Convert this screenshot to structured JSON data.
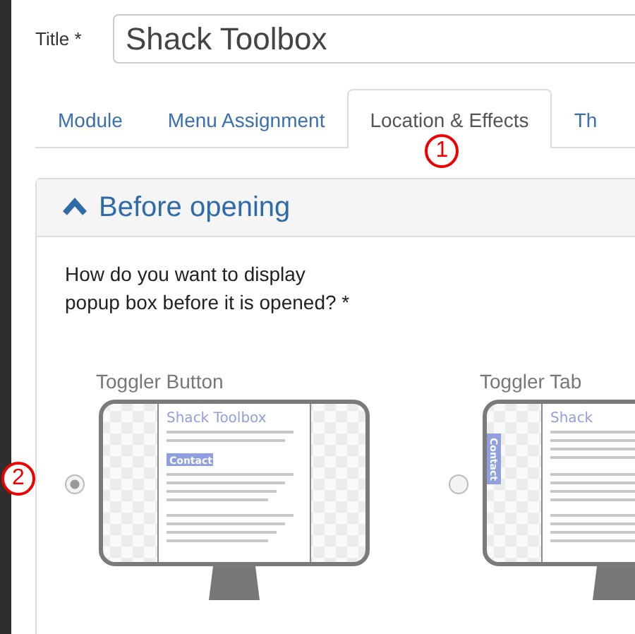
{
  "title_field": {
    "label": "Title *",
    "value": "Shack Toolbox"
  },
  "tabs": [
    {
      "label": "Module",
      "selected": false
    },
    {
      "label": "Menu Assignment",
      "selected": false
    },
    {
      "label": "Location & Effects",
      "selected": true,
      "annotation": "1"
    },
    {
      "label": "Th",
      "selected": false
    }
  ],
  "panel": {
    "title": "Before opening",
    "expanded": true,
    "question": "How do you want to display popup box before it is opened? *",
    "options": [
      {
        "label": "Toggler Button",
        "kind": "button",
        "selected": true,
        "annotation": "2",
        "preview_title": "Shack Toolbox",
        "preview_button": "Contact"
      },
      {
        "label": "Toggler Tab",
        "kind": "tab",
        "selected": false,
        "preview_title": "Shack",
        "preview_button": "Contact"
      }
    ]
  }
}
